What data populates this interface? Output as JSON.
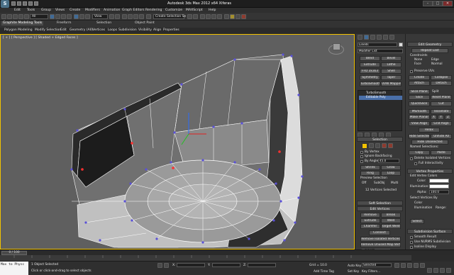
{
  "window": {
    "title": "Autodesk 3ds Max  2012 x64      Xiferas",
    "minimize": "–",
    "maximize": "□",
    "close": "✕"
  },
  "menu": [
    "Edit",
    "Tools",
    "Group",
    "Views",
    "Create",
    "Modifiers",
    "Animation",
    "Graph Editors",
    "Rendering",
    "Customize",
    "MAXScript",
    "Help"
  ],
  "toolbar": {
    "filter_value": "All",
    "view_value": "View",
    "selection_set_placeholder": "Create Selection Se"
  },
  "ribbon": {
    "tabs": [
      "Graphite Modeling Tools",
      "Freeform",
      "Selection",
      "Object Paint"
    ],
    "subtabs": [
      "Polygon Modeling",
      "Modify Selection",
      "Edit",
      "Geometry (All)",
      "Vertices",
      "Loops",
      "Subdivision",
      "Visibility",
      "Align",
      "Properties"
    ]
  },
  "viewport": {
    "label": "[ + ] [ Perspective ] [ Shaded + Edged Faces ]"
  },
  "command_panel": {
    "object_name": "Lineds",
    "modifier_list": "Modifier List",
    "modifier_buttons": [
      "Bend",
      "Bevel",
      "Extrude",
      "Lathe",
      "FFD 3x3x3",
      "Shell",
      "Symmetry",
      "Taper",
      "TurboSmooth",
      "UVW Mapping Cle"
    ],
    "stack": [
      "TurboSmooth",
      "Editable Poly"
    ],
    "selection": {
      "header": "Selection",
      "by_vertex": "By Vertex",
      "ignore_backfacing": "Ignore Backfacing",
      "by_angle": "By Angle:",
      "by_angle_value": "45.0",
      "shrink": "Shrink",
      "grow": "Grow",
      "ring": "Ring",
      "loop": "Loop",
      "preview_selection": "Preview Selection",
      "preview_options": [
        "Off",
        "SubObj",
        "Multi"
      ],
      "status": "12 Vertices Selected"
    },
    "soft_selection": "Soft Selection",
    "edit_vertices": {
      "header": "Edit Vertices",
      "remove": "Remove",
      "break": "Break",
      "extrude": "Extrude",
      "weld": "Weld",
      "chamfer": "Chamfer",
      "target_weld": "Target Weld",
      "connect": "Connect",
      "remove_isolated": "Remove Isolated Vertices",
      "remove_unused": "Remove Unused Map Verts",
      "weight_label": "Weight:",
      "weight_value": "1.0"
    }
  },
  "right_panel": {
    "edit_geometry": {
      "header": "Edit Geometry",
      "repeat_last": "Repeat Last",
      "constraints": "Constraints",
      "constraint_options": [
        "None",
        "Edge",
        "Face",
        "Normal"
      ],
      "preserve_uvs": "Preserve UVs",
      "create": "Create",
      "collapse": "Collapse",
      "attach": "Attach",
      "detach": "Detach",
      "slice_plane": "Slice Plane",
      "split": "Split",
      "slice": "Slice",
      "reset_plane": "Reset Plane",
      "quickslice": "QuickSlice",
      "cut": "Cut",
      "msmooth": "MSmooth",
      "tessellate": "Tessellate",
      "make_planar": "Make Planar",
      "xyz": [
        "X",
        "Y",
        "Z"
      ],
      "view_align": "View Align",
      "grid_align": "Grid Align",
      "relax": "Relax",
      "hide_selected": "Hide Selected",
      "unhide_all": "Unhide All",
      "hide_unselected": "Hide Unselected",
      "named_selections": "Named Selections:",
      "copy": "Copy",
      "paste": "Paste",
      "delete_isolated": "Delete Isolated Vertices",
      "full_interactivity": "Full Interactivity"
    },
    "vertex_properties": {
      "header": "Vertex Properties",
      "edit_vertex_colors": "Edit Vertex Colors",
      "color": "Color:",
      "illumination": "Illumination:",
      "alpha": "Alpha:",
      "alpha_value": "100.0",
      "select_vertices_by": "Select Vertices By",
      "color_option": "Color",
      "illumination_option": "Illumination",
      "range": "Range:",
      "select": "Select"
    },
    "subdivision_surface": {
      "header": "Subdivision Surface",
      "smooth_result": "Smooth Result",
      "use_nurms": "Use NURMS Subdivision",
      "isoline_display": "Isoline Display",
      "show_cage": "Show Cage.....",
      "display": "Display",
      "iterations": "Iterations:",
      "iterations_value": "1"
    }
  },
  "timeline": {
    "frame": "0 / 100"
  },
  "status": {
    "maxscript": "Max to Physc",
    "objects_selected": "1 Object Selected",
    "prompt": "Click or click-and-drag to select objects",
    "x_label": "X:",
    "y_label": "Y:",
    "z_label": "Z:",
    "grid": "Grid = 10.0",
    "auto_key": "Auto Key",
    "selected": "Selected",
    "set_key": "Set Key",
    "key_filters": "Key Filters...",
    "add_time_tag": "Add Time Tag"
  },
  "colors": {
    "viewport_border": "#f2c200",
    "selected_vertex": "#ff3030",
    "vertex": "#5a50d8",
    "wire": "#ffffff"
  }
}
